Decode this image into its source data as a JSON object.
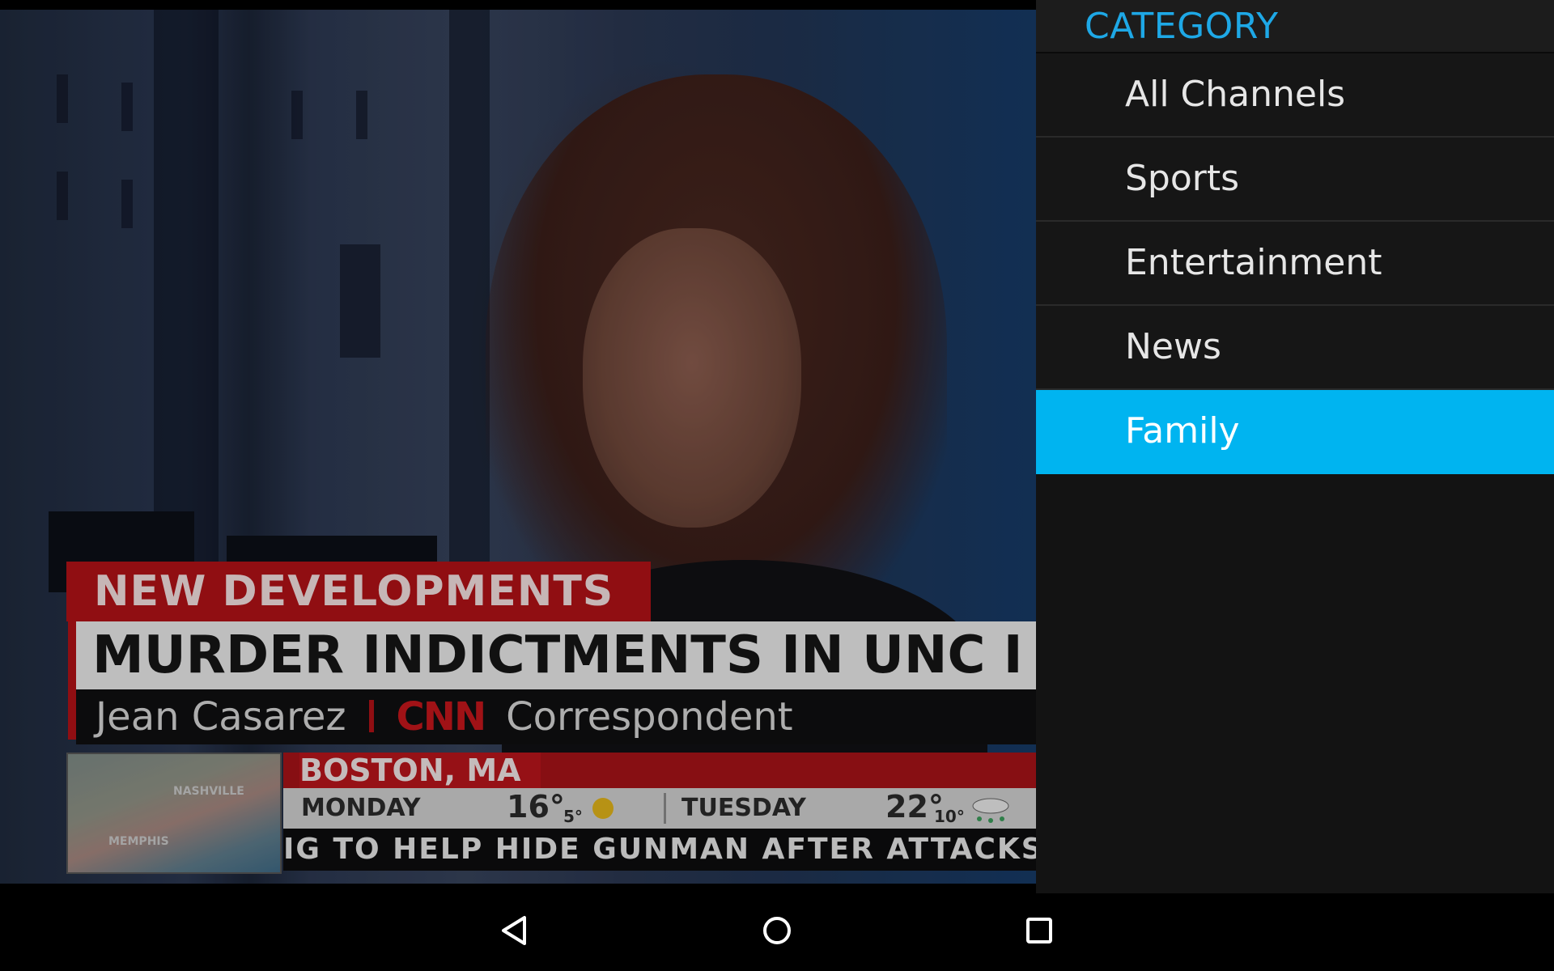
{
  "video": {
    "lower_third": {
      "tag": "NEW DEVELOPMENTS",
      "headline": "MURDER INDICTMENTS IN UNC I",
      "name": "Jean Casarez",
      "network": "CNN",
      "role": "Correspondent",
      "map_cities": [
        "NASHVILLE",
        "MEMPHIS"
      ],
      "location": "BOSTON, MA",
      "forecast": [
        {
          "day": "MONDAY",
          "high": "16°",
          "low": "5°"
        },
        {
          "day": "TUESDAY",
          "high": "22°",
          "low": "10°"
        }
      ],
      "ticker": "IG TO HELP HIDE GUNMAN AFTER ATTACKS AT"
    }
  },
  "category_panel": {
    "title": "CATEGORY",
    "items": [
      {
        "label": "All Channels",
        "selected": false
      },
      {
        "label": "Sports",
        "selected": false
      },
      {
        "label": "Entertainment",
        "selected": false
      },
      {
        "label": "News",
        "selected": false
      },
      {
        "label": "Family",
        "selected": true
      }
    ],
    "accent_color": "#00b4f0",
    "title_color": "#1ea8e6"
  },
  "navbar": {
    "buttons": [
      "back-icon",
      "home-icon",
      "recents-icon"
    ]
  }
}
